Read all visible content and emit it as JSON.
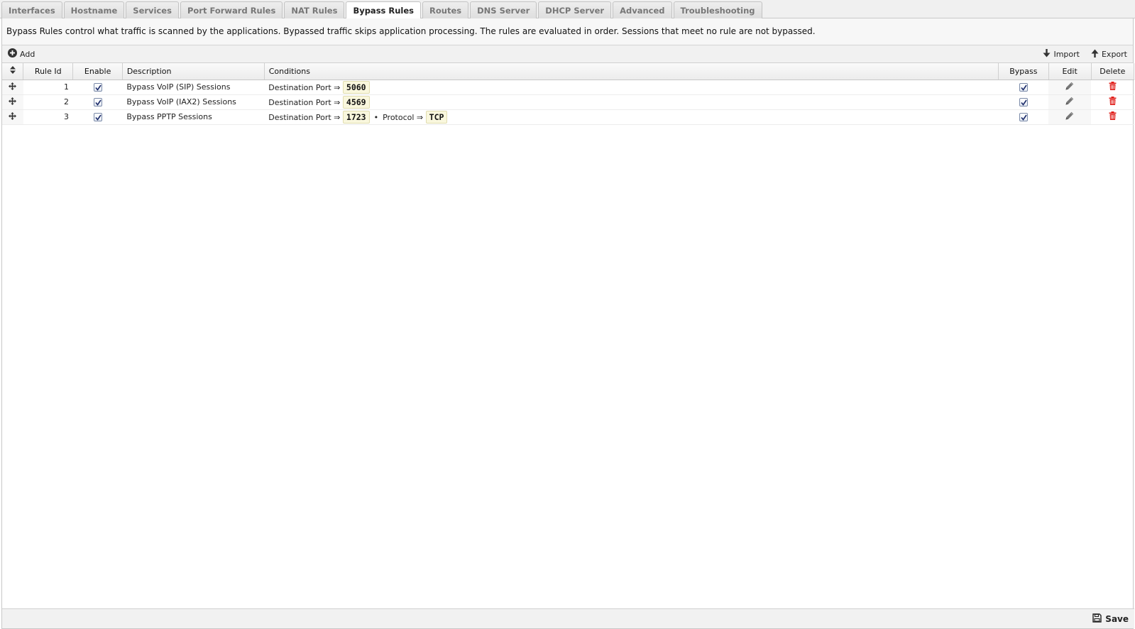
{
  "tabs": [
    {
      "label": "Interfaces"
    },
    {
      "label": "Hostname"
    },
    {
      "label": "Services"
    },
    {
      "label": "Port Forward Rules"
    },
    {
      "label": "NAT Rules"
    },
    {
      "label": "Bypass Rules",
      "active": true
    },
    {
      "label": "Routes"
    },
    {
      "label": "DNS Server"
    },
    {
      "label": "DHCP Server"
    },
    {
      "label": "Advanced"
    },
    {
      "label": "Troubleshooting"
    }
  ],
  "description": "Bypass Rules control what traffic is scanned by the applications. Bypassed traffic skips application processing. The rules are evaluated in order. Sessions that meet no rule are not bypassed.",
  "toolbar": {
    "add_label": "Add",
    "import_label": "Import",
    "export_label": "Export"
  },
  "table": {
    "headers": {
      "rule_id": "Rule Id",
      "enable": "Enable",
      "description": "Description",
      "conditions": "Conditions",
      "bypass": "Bypass",
      "edit": "Edit",
      "delete": "Delete"
    },
    "rows": [
      {
        "rule_id": "1",
        "enabled": true,
        "description": "Bypass VoIP (SIP) Sessions",
        "conditions": [
          {
            "label": "Destination Port ⇒",
            "value": "5060"
          }
        ],
        "bypass": true
      },
      {
        "rule_id": "2",
        "enabled": true,
        "description": "Bypass VoIP (IAX2) Sessions",
        "conditions": [
          {
            "label": "Destination Port ⇒",
            "value": "4569"
          }
        ],
        "bypass": true
      },
      {
        "rule_id": "3",
        "enabled": true,
        "description": "Bypass PPTP Sessions",
        "conditions": [
          {
            "label": "Destination Port ⇒",
            "value": "1723"
          },
          {
            "label": "Protocol ⇒",
            "value": "TCP"
          }
        ],
        "bypass": true
      }
    ]
  },
  "footer": {
    "save_label": "Save"
  },
  "colors": {
    "delete_icon": "#e0201c",
    "edit_icon": "#666666",
    "add_icon": "#333333",
    "condition_badge_bg": "#f9f7dd"
  }
}
